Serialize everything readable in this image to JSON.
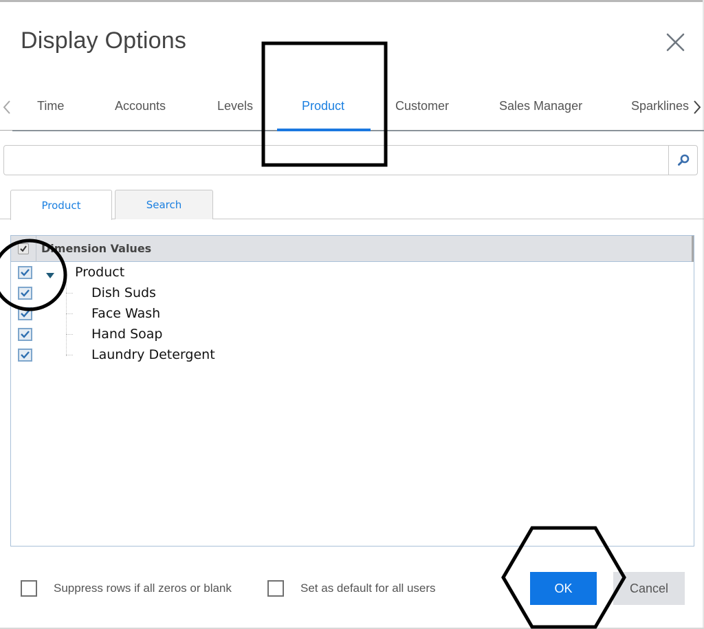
{
  "dialog": {
    "title": "Display Options",
    "close_icon": "close-x-icon"
  },
  "main_tabs": {
    "prev_icon": "chevron-left-icon",
    "next_icon": "chevron-right-icon",
    "items": [
      {
        "label": "Time",
        "active": false
      },
      {
        "label": "Accounts",
        "active": false
      },
      {
        "label": "Levels",
        "active": false
      },
      {
        "label": "Product",
        "active": true
      },
      {
        "label": "Customer",
        "active": false
      },
      {
        "label": "Sales Manager",
        "active": false
      },
      {
        "label": "Sparklines",
        "active": false
      }
    ]
  },
  "search": {
    "value": "",
    "placeholder": "",
    "button_icon": "search-icon"
  },
  "sub_tabs": [
    {
      "label": "Product",
      "active": true
    },
    {
      "label": "Search",
      "active": false
    }
  ],
  "grid": {
    "header_label": "Dimension Values",
    "header_checked": true,
    "rows": [
      {
        "label": "Product",
        "checked": true,
        "level": 0,
        "expanded": true
      },
      {
        "label": "Dish Suds",
        "checked": true,
        "level": 1
      },
      {
        "label": "Face Wash",
        "checked": true,
        "level": 1
      },
      {
        "label": "Hand Soap",
        "checked": true,
        "level": 1
      },
      {
        "label": "Laundry Detergent",
        "checked": true,
        "level": 1
      }
    ]
  },
  "footer": {
    "options": [
      {
        "label": "Suppress rows if all zeros or blank",
        "checked": false
      },
      {
        "label": "Set as default for all users",
        "checked": false
      }
    ],
    "ok_label": "OK",
    "cancel_label": "Cancel"
  },
  "colors": {
    "accent": "#1a78e0",
    "ok_button": "#0f76e4",
    "cancel_button": "#dfe1e5",
    "grid_header": "#dfe1e5",
    "tree_toggle": "#1f5a78"
  },
  "annotations": [
    {
      "shape": "rectangle",
      "target": "tab-product"
    },
    {
      "shape": "circle",
      "target": "product-checkboxes"
    },
    {
      "shape": "hexagon",
      "target": "ok-button"
    }
  ]
}
